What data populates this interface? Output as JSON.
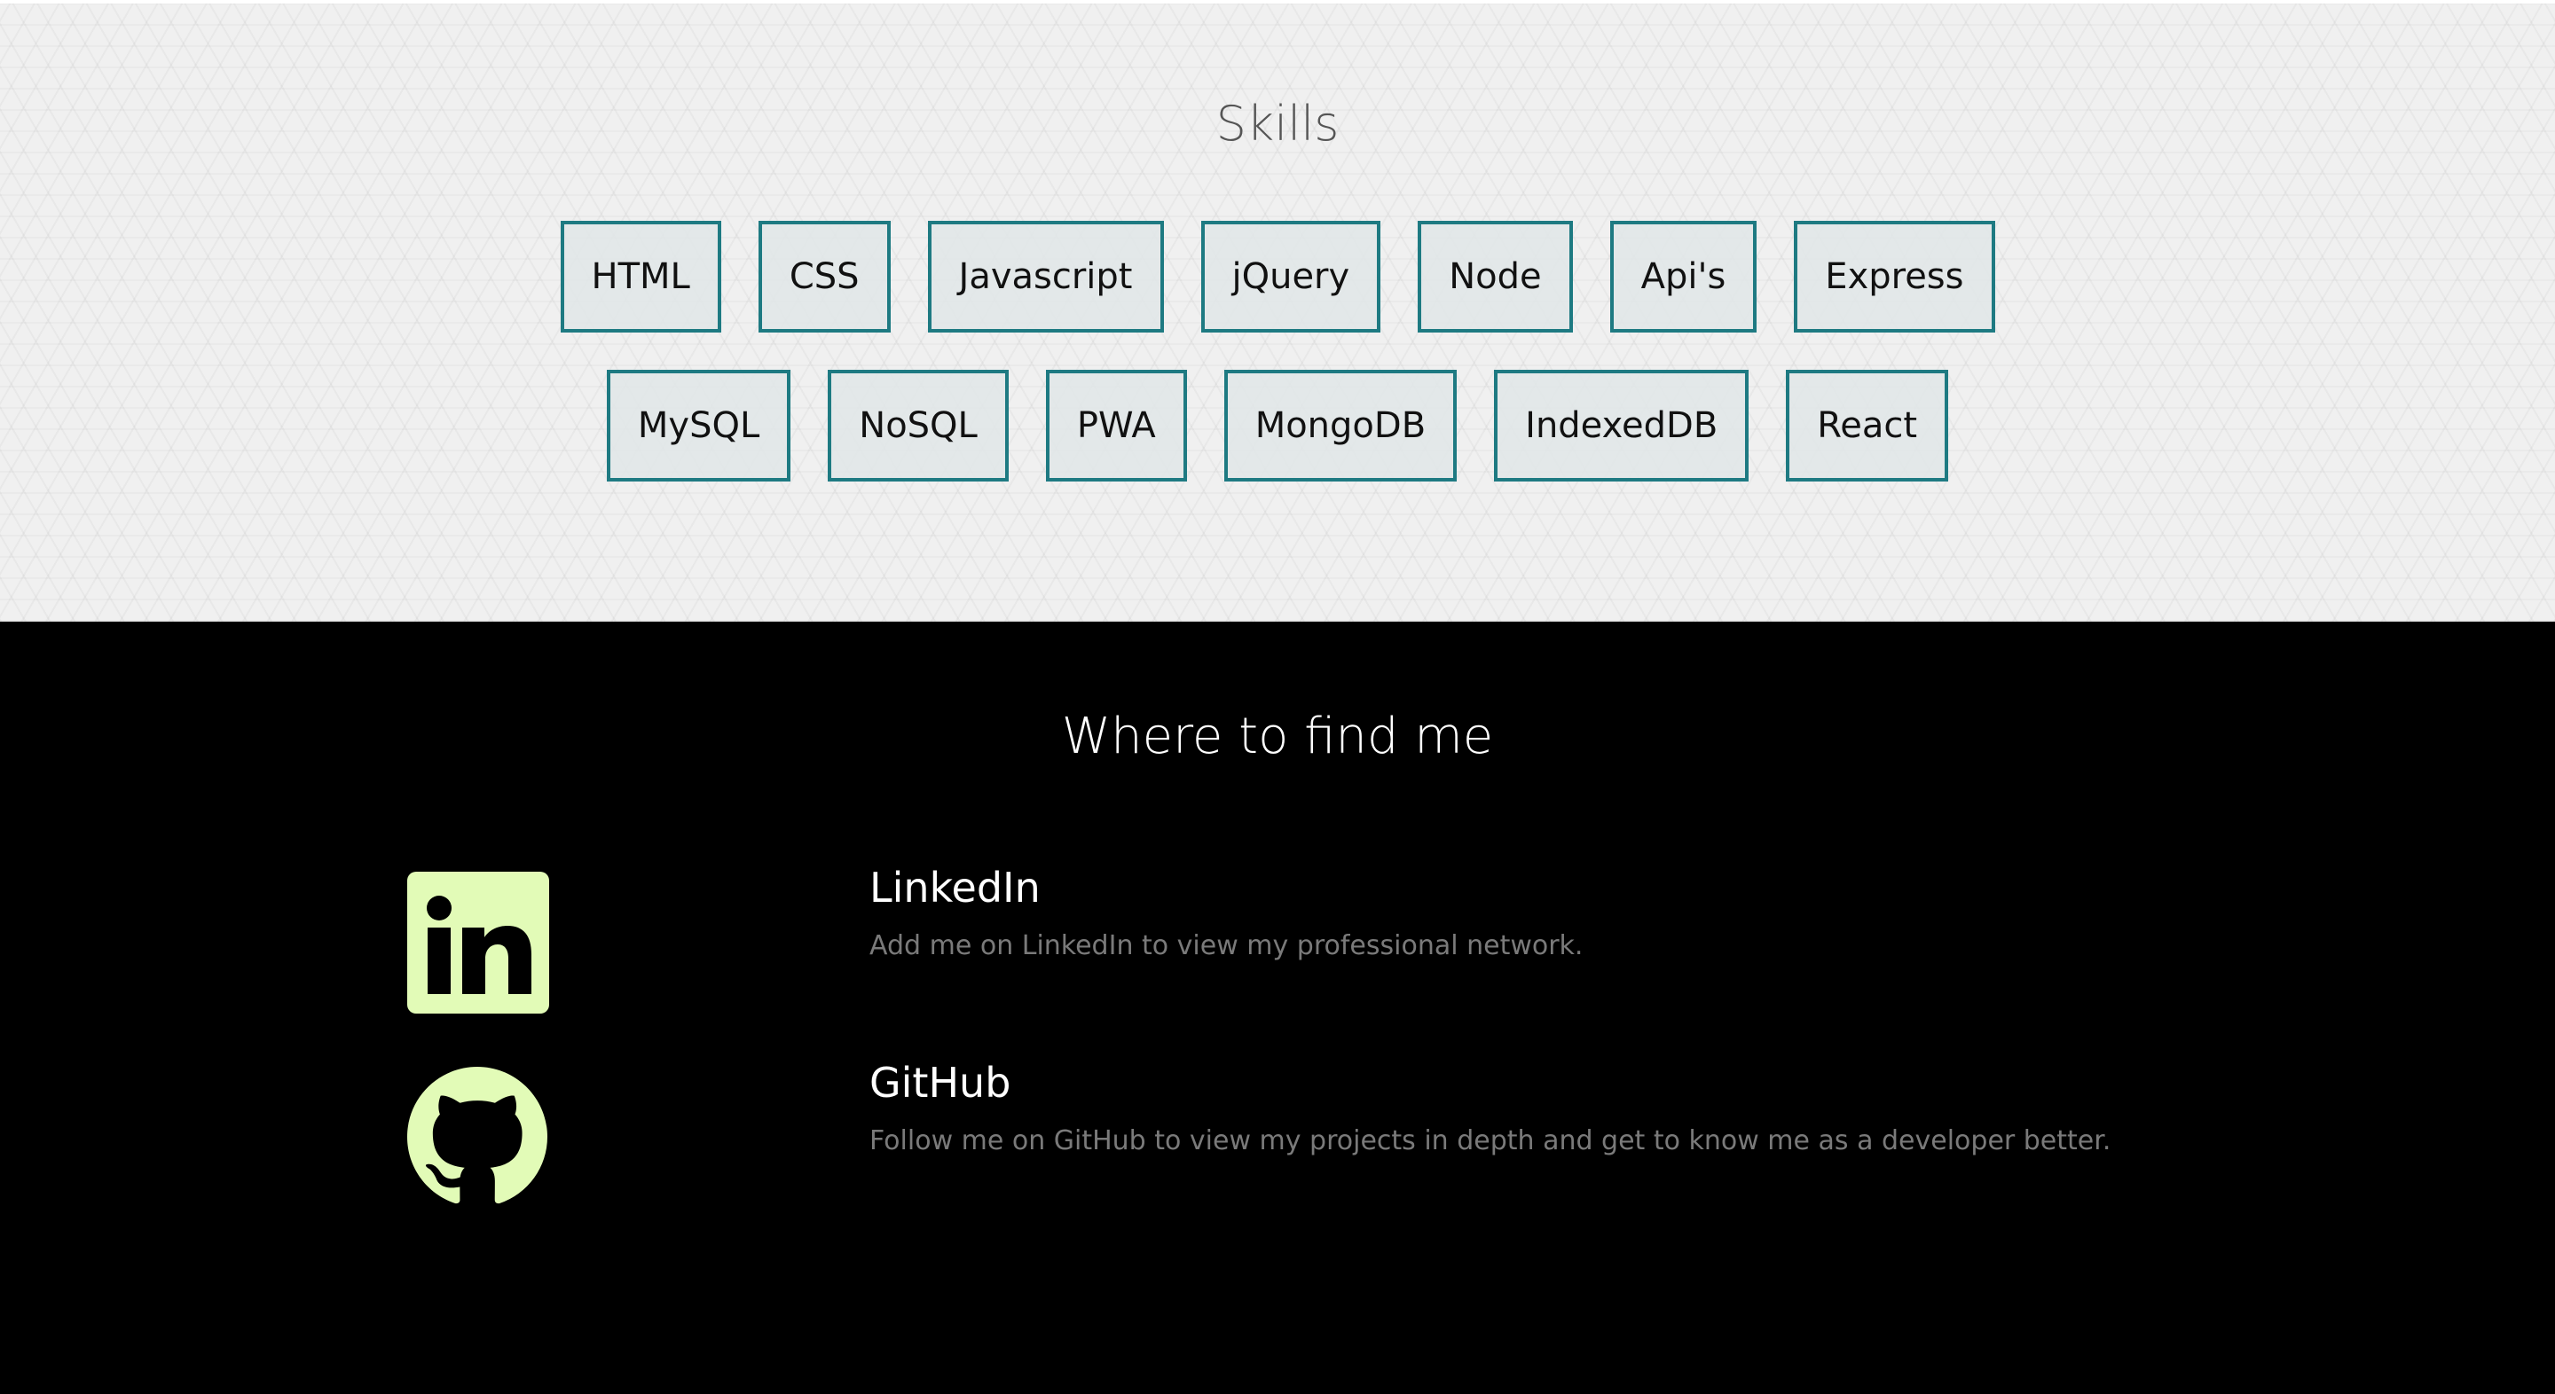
{
  "skills": {
    "title": "Skills",
    "row1": [
      "HTML",
      "CSS",
      "Javascript",
      "jQuery",
      "Node",
      "Api's",
      "Express"
    ],
    "row2": [
      "MySQL",
      "NoSQL",
      "PWA",
      "MongoDB",
      "IndexedDB",
      "React"
    ]
  },
  "find": {
    "title": "Where to find me",
    "items": [
      {
        "name": "LinkedIn",
        "description": "Add me on LinkedIn to view my professional network.",
        "icon": "linkedin-icon"
      },
      {
        "name": "GitHub",
        "description": "Follow me on GitHub to view my projects in depth and get to know me as a developer better.",
        "icon": "github-icon"
      }
    ]
  },
  "colors": {
    "chip_border": "#1e7a82",
    "icon_color": "#e2fbb7",
    "dark_bg": "#000000"
  }
}
